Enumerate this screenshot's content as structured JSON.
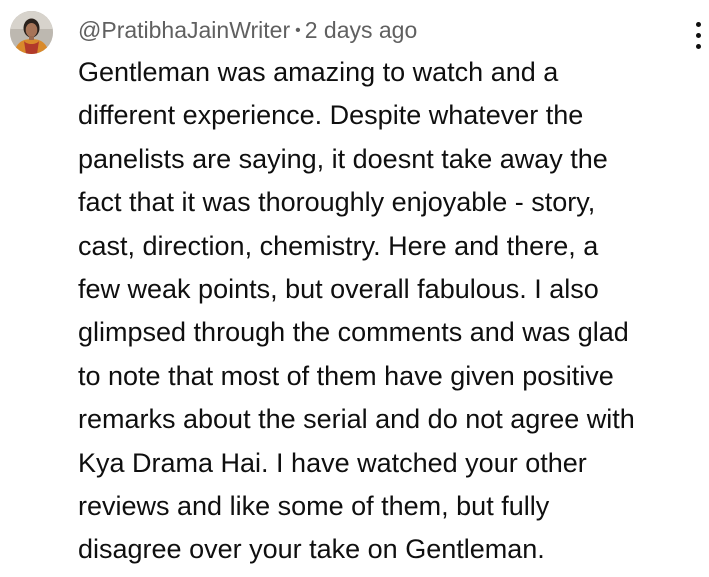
{
  "comment": {
    "author": "@PratibhaJainWriter",
    "separator": "•",
    "timestamp": "2 days ago",
    "avatar_icon": "profile-photo",
    "menu_icon": "more-vertical-icon",
    "lines": [
      "Gentleman was amazing to watch and a",
      "different experience. Despite whatever the",
      "panelists are saying, it doesnt take away the",
      "fact that it was thoroughly enjoyable - story,",
      "cast, direction, chemistry. Here and there, a",
      "few weak points, but overall fabulous. I also",
      "glimpsed through the comments and was glad",
      "to note that most of them have given positive",
      "remarks about the serial and do not agree with",
      "Kya Drama Hai. I have watched your other",
      "reviews and like some of them, but fully",
      "disagree over your take on Gentleman."
    ]
  },
  "colors": {
    "text": "#0f0f0f",
    "meta": "#606060",
    "background": "#ffffff"
  }
}
